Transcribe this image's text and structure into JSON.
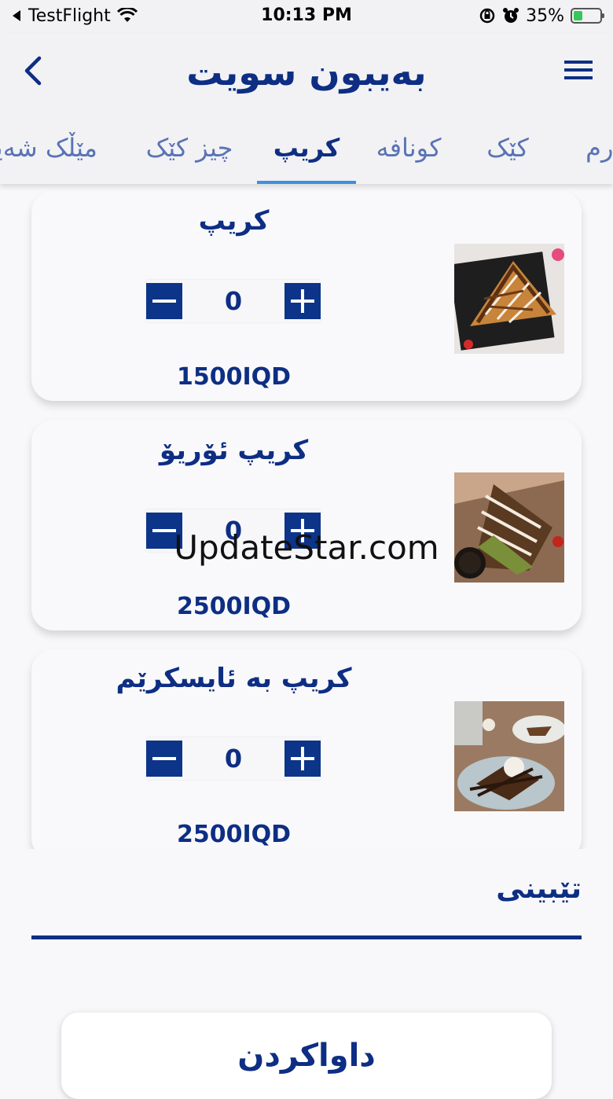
{
  "status_bar": {
    "back_app": "TestFlight",
    "time": "10:13 PM",
    "battery_percent": "35%",
    "battery_level": 0.35
  },
  "header": {
    "title": "بەیبون سویت",
    "back_icon": "chevron-left-icon",
    "menu_icon": "hamburger-menu-icon"
  },
  "tabs": [
    {
      "label": "گەرم",
      "active": false
    },
    {
      "label": "کێک",
      "active": false
    },
    {
      "label": "کونافە",
      "active": false
    },
    {
      "label": "کریپ",
      "active": true
    },
    {
      "label": "چیز کێک",
      "active": false
    },
    {
      "label": "مێڵک شەیک",
      "active": false
    }
  ],
  "items": [
    {
      "name": "کریپ",
      "quantity": "0",
      "price": "1500IQD",
      "image": "crepe-photo"
    },
    {
      "name": "کریپ ئۆریۆ",
      "quantity": "0",
      "price": "2500IQD",
      "image": "oreo-crepe-photo"
    },
    {
      "name": "کریپ بە ئایسکرێم",
      "quantity": "0",
      "price": "2500IQD",
      "image": "ice-cream-crepe-photo"
    }
  ],
  "watermark": "UpdateStar.com",
  "notes": {
    "label": "تێبینی",
    "value": ""
  },
  "order_button": "داواکردن",
  "colors": {
    "primary": "#0d2e83",
    "button": "#0c3489",
    "tab_indicator": "#3d8fe0",
    "background": "#f8f8fa"
  }
}
